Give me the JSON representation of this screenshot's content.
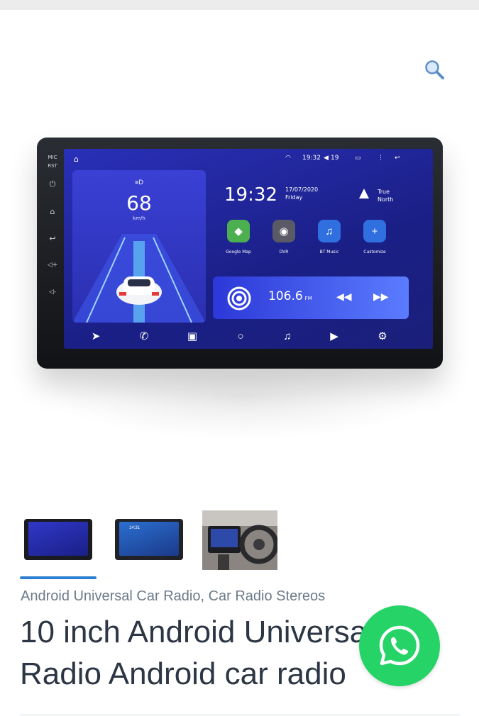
{
  "header": {
    "search_icon": "search-icon"
  },
  "product_image": {
    "stereo": {
      "side_keys": [
        "MIC",
        "RST",
        "⏻",
        "⌂",
        "↩",
        "◁+",
        "◁-"
      ],
      "status_bar": {
        "time": "19:32",
        "volume": "19"
      },
      "speed": "68",
      "speed_unit": "km/h",
      "clock": "19:32",
      "date": "17/07/2020",
      "day": "Friday",
      "compass_line1": "True",
      "compass_line2": "North",
      "apps": [
        {
          "label": "Google Map",
          "icon": "map-icon",
          "color": "#4caf50"
        },
        {
          "label": "DVR",
          "icon": "camera-icon",
          "color": "#5a5a66"
        },
        {
          "label": "BT Music",
          "icon": "music-icon",
          "color": "#2f6fe0"
        },
        {
          "label": "Customize",
          "icon": "plus-icon",
          "color": "#2f6fe0"
        }
      ],
      "radio_freq": "106.6",
      "radio_band": "FM"
    }
  },
  "thumbnails": [
    {
      "alt": "thumbnail-1",
      "active": true
    },
    {
      "alt": "thumbnail-2",
      "active": false
    },
    {
      "alt": "thumbnail-3",
      "active": false
    }
  ],
  "thumbnail_screen_time": "14:31",
  "categories": {
    "items": [
      "Android Universal Car Radio",
      "Car Radio Stereos"
    ],
    "separator": ","
  },
  "product": {
    "title": "10 inch Android Universal Car Radio Android car radio"
  },
  "whatsapp": {
    "icon": "whatsapp-icon",
    "color": "#25d366"
  }
}
